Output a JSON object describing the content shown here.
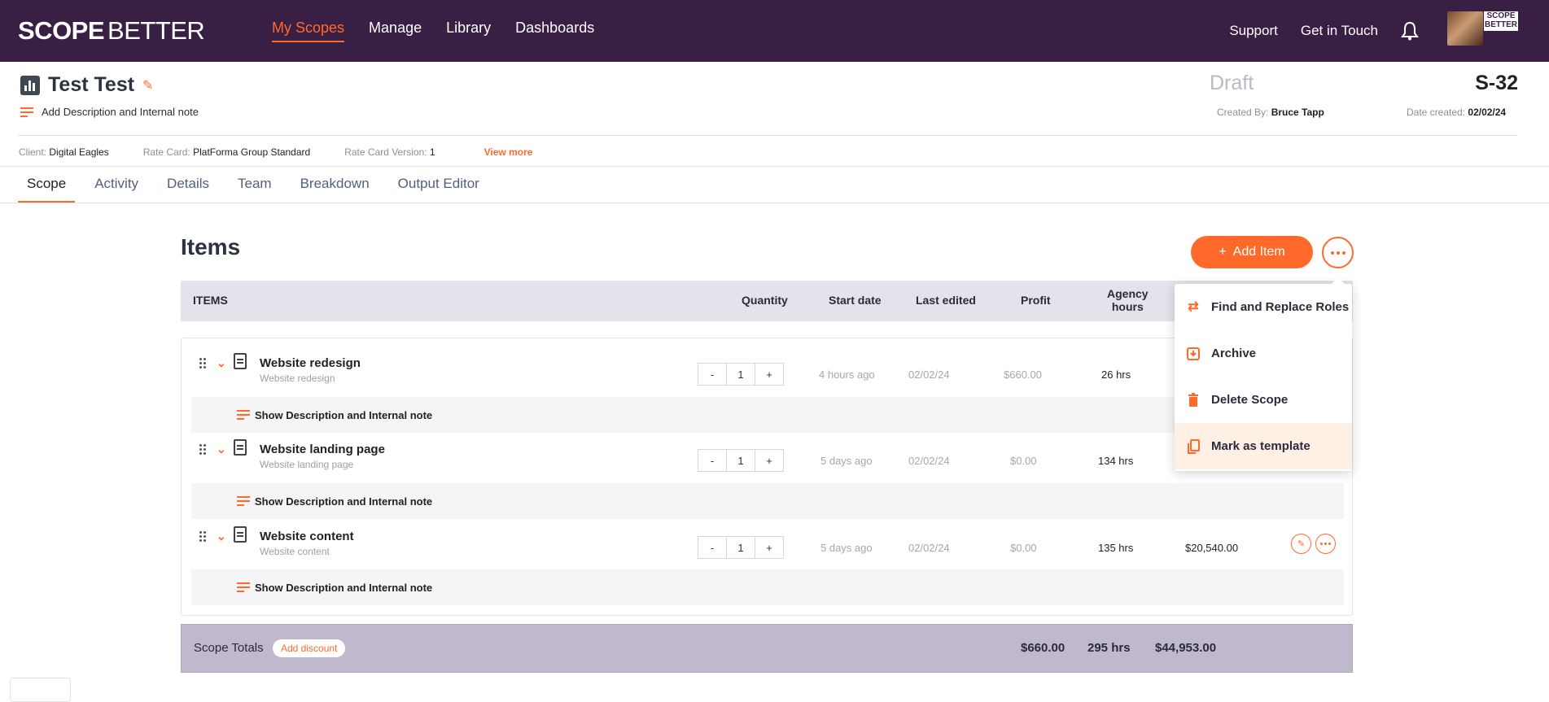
{
  "nav": {
    "logo_part1": "SCOPE",
    "logo_part2": "BETTER",
    "links": [
      "My Scopes",
      "Manage",
      "Library",
      "Dashboards"
    ],
    "right": [
      "Support",
      "Get in Touch"
    ],
    "avatar_logo": "SCOPE BETTER"
  },
  "scope": {
    "title": "Test Test",
    "desc_link": "Add Description and Internal note",
    "status": "Draft",
    "id": "S-32",
    "created_by_label": "Created By:",
    "created_by": "Bruce Tapp",
    "date_label": "Date created:",
    "date": "02/02/24",
    "client_label": "Client:",
    "client": "Digital Eagles",
    "rate_card_label": "Rate Card:",
    "rate_card": "PlatForma Group Standard",
    "rate_version_label": "Rate Card Version:",
    "rate_version": "1",
    "view_more": "View more"
  },
  "tabs": [
    "Scope",
    "Activity",
    "Details",
    "Team",
    "Breakdown",
    "Output Editor"
  ],
  "items_section": {
    "title": "Items",
    "add_item": "Add Item",
    "add_icon": "+"
  },
  "table": {
    "headers": {
      "items": "ITEMS",
      "quantity": "Quantity",
      "start_date": "Start date",
      "last_edited": "Last edited",
      "profit": "Profit",
      "agency_hours_1": "Agency",
      "agency_hours_2": "hours"
    },
    "rows": [
      {
        "name": "Website redesign",
        "sub": "Website redesign",
        "qty": "1",
        "start": "4 hours ago",
        "edited": "02/02/24",
        "profit": "$660.00",
        "hours": "26 hrs",
        "price": ""
      },
      {
        "name": "Website landing page",
        "sub": "Website landing page",
        "qty": "1",
        "start": "5 days ago",
        "edited": "02/02/24",
        "profit": "$0.00",
        "hours": "134 hrs",
        "price": ""
      },
      {
        "name": "Website content",
        "sub": "Website content",
        "qty": "1",
        "start": "5 days ago",
        "edited": "02/02/24",
        "profit": "$0.00",
        "hours": "135 hrs",
        "price": "$20,540.00"
      }
    ],
    "show_desc": "Show Description and Internal note",
    "minus": "-",
    "plus": "+"
  },
  "totals": {
    "label": "Scope Totals",
    "discount": "Add discount",
    "profit": "$660.00",
    "hours": "295 hrs",
    "price": "$44,953.00"
  },
  "menu": {
    "items": [
      "Find and Replace Roles",
      "Archive",
      "Delete Scope",
      "Mark as template"
    ]
  },
  "colors": {
    "accent": "#ff6a2b",
    "nav_bg": "#3a1f45",
    "totals_bg": "#c0b8cd"
  }
}
